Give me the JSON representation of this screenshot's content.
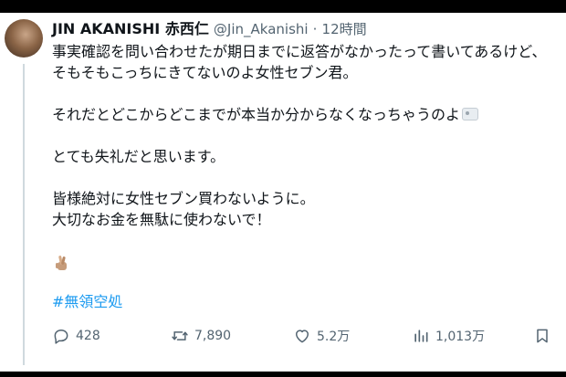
{
  "tweet": {
    "author_name": "JIN AKANISHI 赤西仁",
    "handle": "@Jin_Akanishi",
    "separator": "·",
    "time": "12時間",
    "lines": [
      "事実確認を問い合わせたが期日までに返答がなかったって書いてあるけど、",
      "そもそもこっちにきてないのよ女性セブン君。",
      "",
      "それだとどこからどこまでが本当か分からなくなっちゃうのよ",
      "",
      "とても失礼だと思います。",
      "",
      "皆様絶対に女性セブン買わないように。",
      "大切なお金を無駄に使わないで！"
    ],
    "emoji_icons": [
      "tissue-box-icon",
      "crossed-fingers-icon"
    ],
    "hashtag": "#無領空処"
  },
  "actions": {
    "reply_count": "428",
    "retweet_count": "7,890",
    "like_count": "5.2万",
    "view_count": "1,013万"
  },
  "colors": {
    "text": "#0f1419",
    "secondary": "#536471",
    "link": "#1d9bf0",
    "background": "#ffffff",
    "frame": "#000000"
  }
}
